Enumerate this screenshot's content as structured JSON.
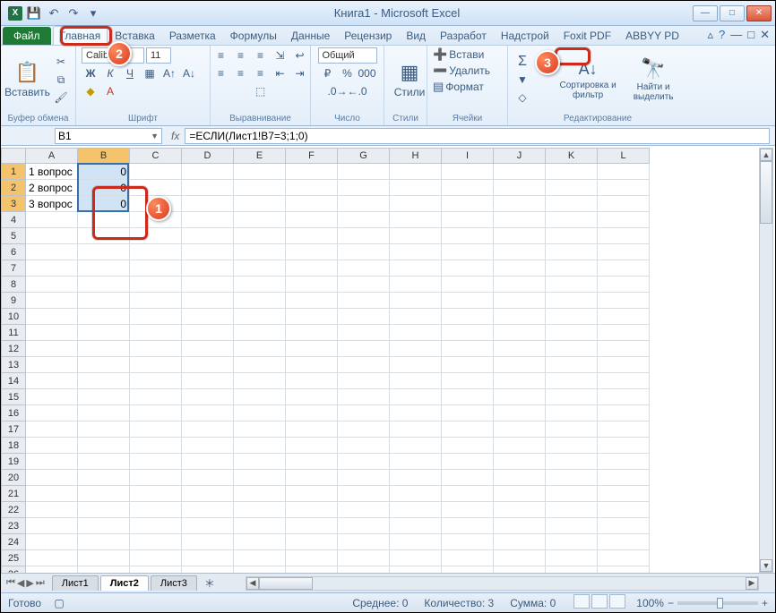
{
  "window": {
    "title": "Книга1  -  Microsoft Excel"
  },
  "qat_icons": [
    "excel",
    "save",
    "undo",
    "redo",
    "open",
    "print"
  ],
  "tabs": {
    "file": "Файл",
    "items": [
      "Главная",
      "Вставка",
      "Разметка",
      "Формулы",
      "Данные",
      "Рецензир",
      "Вид",
      "Разработ",
      "Надстрой",
      "Foxit PDF",
      "ABBYY PD"
    ],
    "active": 0
  },
  "ribbon": {
    "clipboard": {
      "paste": "Вставить",
      "label": "Буфер обмена"
    },
    "font": {
      "name": "Calibri",
      "size": "11",
      "label": "Шрифт"
    },
    "alignment": {
      "label": "Выравнивание"
    },
    "number": {
      "format": "Общий",
      "label": "Число"
    },
    "styles": {
      "label": "Стили",
      "btn": "Стили"
    },
    "cells": {
      "insert": "Встави",
      "delete": "Удалить",
      "format": "Формат",
      "label": "Ячейки"
    },
    "editing": {
      "sort": "Сортировка и фильтр",
      "find": "Найти и выделить",
      "label": "Редактирование"
    }
  },
  "namebox": "B1",
  "formula": "=ЕСЛИ(Лист1!B7=3;1;0)",
  "columns": [
    "A",
    "B",
    "C",
    "D",
    "E",
    "F",
    "G",
    "H",
    "I",
    "J",
    "K",
    "L"
  ],
  "rows": 28,
  "data": {
    "A1": "1 вопрос",
    "B1": "0",
    "A2": "2 вопрос",
    "B2": "0",
    "A3": "3 вопрос",
    "B3": "0"
  },
  "selection": {
    "col": "B",
    "rows": [
      1,
      2,
      3
    ]
  },
  "sheets": {
    "items": [
      "Лист1",
      "Лист2",
      "Лист3"
    ],
    "active": 1
  },
  "status": {
    "ready": "Готово",
    "avg": "Среднее: 0",
    "count": "Количество: 3",
    "sum": "Сумма: 0",
    "zoom": "100%"
  },
  "callouts": {
    "1": "1",
    "2": "2",
    "3": "3"
  }
}
